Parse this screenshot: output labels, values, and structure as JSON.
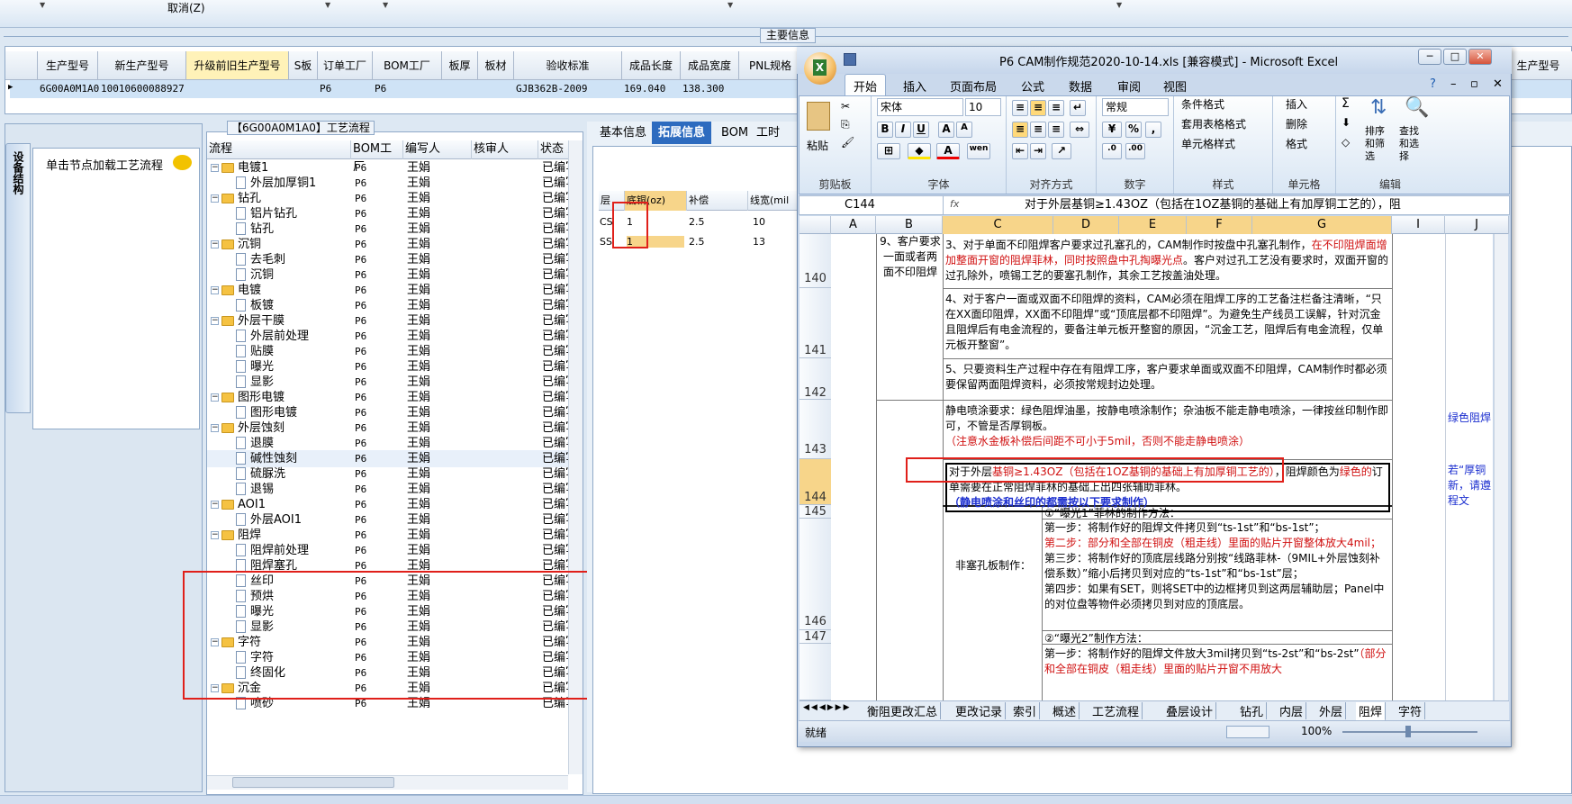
{
  "top": {
    "cancel_label": "取消(Z)"
  },
  "main_info": {
    "title": "主要信息",
    "headers": [
      "生产型号",
      "新生产型号",
      "升级前旧生产型号",
      "S板",
      "订单工厂",
      "BOM工厂",
      "板厚",
      "板材",
      "验收标准",
      "成品长度",
      "成品宽度",
      "PNL规格",
      "生产型号"
    ],
    "row": {
      "prod_no": "6G00A0M1A0",
      "new_prod_no": "10010600088927",
      "order_factory": "P6",
      "bom_factory": "P6",
      "standard": "GJB362B-2009",
      "length": "169.040",
      "width": "138.300"
    }
  },
  "left": {
    "vtab": "设备结构",
    "load_hint": "单击节点加载工艺流程"
  },
  "tree": {
    "title": "【6G00A0M1A0】工艺流程",
    "headers": [
      "流程",
      "BOM工厂",
      "编写人",
      "核审人",
      "状态"
    ],
    "rows": [
      {
        "name": "电镀1",
        "type": "group",
        "bom": "P6",
        "writer": "王娟",
        "status": "已编写"
      },
      {
        "name": "外层加厚铜1",
        "type": "item",
        "bom": "P6",
        "writer": "王娟",
        "status": "已编写"
      },
      {
        "name": "钻孔",
        "type": "group",
        "bom": "P6",
        "writer": "王娟",
        "status": "已编写"
      },
      {
        "name": "铝片钻孔",
        "type": "item",
        "bom": "P6",
        "writer": "王娟",
        "status": "已编写"
      },
      {
        "name": "钻孔",
        "type": "item",
        "bom": "P6",
        "writer": "王娟",
        "status": "已编写"
      },
      {
        "name": "沉铜",
        "type": "group",
        "bom": "P6",
        "writer": "王娟",
        "status": "已编写"
      },
      {
        "name": "去毛刺",
        "type": "item",
        "bom": "P6",
        "writer": "王娟",
        "status": "已编写"
      },
      {
        "name": "沉铜",
        "type": "item",
        "bom": "P6",
        "writer": "王娟",
        "status": "已编写"
      },
      {
        "name": "电镀",
        "type": "group",
        "bom": "P6",
        "writer": "王娟",
        "status": "已编写"
      },
      {
        "name": "板镀",
        "type": "item",
        "bom": "P6",
        "writer": "王娟",
        "status": "已编写"
      },
      {
        "name": "外层干膜",
        "type": "group",
        "bom": "P6",
        "writer": "王娟",
        "status": "已编写"
      },
      {
        "name": "外层前处理",
        "type": "item",
        "bom": "P6",
        "writer": "王娟",
        "status": "已编写"
      },
      {
        "name": "贴膜",
        "type": "item",
        "bom": "P6",
        "writer": "王娟",
        "status": "已编写"
      },
      {
        "name": "曝光",
        "type": "item",
        "bom": "P6",
        "writer": "王娟",
        "status": "已编写"
      },
      {
        "name": "显影",
        "type": "item",
        "bom": "P6",
        "writer": "王娟",
        "status": "已编写"
      },
      {
        "name": "图形电镀",
        "type": "group",
        "bom": "P6",
        "writer": "王娟",
        "status": "已编写"
      },
      {
        "name": "图形电镀",
        "type": "item",
        "bom": "P6",
        "writer": "王娟",
        "status": "已编写"
      },
      {
        "name": "外层蚀刻",
        "type": "group",
        "bom": "P6",
        "writer": "王娟",
        "status": "已编写"
      },
      {
        "name": "退膜",
        "type": "item",
        "bom": "P6",
        "writer": "王娟",
        "status": "已编写"
      },
      {
        "name": "碱性蚀刻",
        "type": "item",
        "bom": "P6",
        "writer": "王娟",
        "status": "已编写"
      },
      {
        "name": "硫脲洗",
        "type": "item",
        "bom": "P6",
        "writer": "王娟",
        "status": "已编写"
      },
      {
        "name": "退锡",
        "type": "item",
        "bom": "P6",
        "writer": "王娟",
        "status": "已编写"
      },
      {
        "name": "AOI1",
        "type": "group",
        "bom": "P6",
        "writer": "王娟",
        "status": "已编写"
      },
      {
        "name": "外层AOI1",
        "type": "item",
        "bom": "P6",
        "writer": "王娟",
        "status": "已编写"
      },
      {
        "name": "阻焊",
        "type": "group",
        "bom": "P6",
        "writer": "王娟",
        "status": "已编写"
      },
      {
        "name": "阻焊前处理",
        "type": "item",
        "bom": "P6",
        "writer": "王娟",
        "status": "已编写"
      },
      {
        "name": "阻焊塞孔",
        "type": "item",
        "bom": "P6",
        "writer": "王娟",
        "status": "已编写"
      },
      {
        "name": "丝印",
        "type": "item",
        "bom": "P6",
        "writer": "王娟",
        "status": "已编写"
      },
      {
        "name": "预烘",
        "type": "item",
        "bom": "P6",
        "writer": "王娟",
        "status": "已编写"
      },
      {
        "name": "曝光",
        "type": "item",
        "bom": "P6",
        "writer": "王娟",
        "status": "已编写"
      },
      {
        "name": "显影",
        "type": "item",
        "bom": "P6",
        "writer": "王娟",
        "status": "已编写"
      },
      {
        "name": "字符",
        "type": "group",
        "bom": "P6",
        "writer": "王娟",
        "status": "已编写"
      },
      {
        "name": "字符",
        "type": "item",
        "bom": "P6",
        "writer": "王娟",
        "status": "已编写"
      },
      {
        "name": "终固化",
        "type": "item",
        "bom": "P6",
        "writer": "王娟",
        "status": "已编写"
      },
      {
        "name": "沉金",
        "type": "group",
        "bom": "P6",
        "writer": "王娟",
        "status": "已编写"
      },
      {
        "name": "喷砂",
        "type": "item",
        "bom": "P6",
        "writer": "王娟",
        "status": "已编写"
      }
    ]
  },
  "right": {
    "tabs": [
      "基本信息",
      "拓展信息",
      "BOM",
      "工时"
    ],
    "active_tab": "拓展信息",
    "grid_headers": [
      "层",
      "底铜(oz)",
      "补偿",
      "线宽(mil"
    ],
    "grid_rows": [
      [
        "CS",
        "1",
        "2.5",
        "10"
      ],
      [
        "SS",
        "1",
        "2.5",
        "13"
      ]
    ]
  },
  "excel": {
    "title": "P6 CAM制作规范2020-10-14.xls [兼容模式] - Microsoft Excel",
    "ribbon_tabs": [
      "开始",
      "插入",
      "页面布局",
      "公式",
      "数据",
      "审阅",
      "视图"
    ],
    "font_name": "宋体",
    "font_size": "10",
    "number_format": "常规",
    "clipboard": {
      "paste": "粘贴",
      "label": "剪贴板"
    },
    "font_label": "字体",
    "align_label": "对齐方式",
    "number_label": "数字",
    "style_label": "样式",
    "cells_label": "单元格",
    "edit_label": "编辑",
    "style_btns": [
      "条件格式",
      "套用表格格式",
      "单元格样式"
    ],
    "cell_btns": [
      "插入",
      "删除",
      "格式"
    ],
    "edit_btns": [
      "排序和筛选",
      "查找和选择"
    ],
    "name_box": "C144",
    "formula": "对于外层基铜≥1.43OZ（包括在1OZ基铜的基础上有加厚铜工艺的），阻",
    "columns": [
      "A",
      "B",
      "C",
      "D",
      "E",
      "F",
      "G",
      "I",
      "J"
    ],
    "b_label": "9、客户要求一面或者两面不印阻焊",
    "r140": "3、对于单面不印阻焊客户要求过孔塞孔的，CAM制作时按盘中孔塞孔制作，",
    "r140_red": "在不印阻焊面增加整面开窗的阻焊菲林，同时按照盘中孔掏曝光点",
    "r140_tail": "。客户对过孔工艺没有要求时，双面开窗的过孔除外，喷锡工艺的要塞孔制作，其余工艺按盖油处理。",
    "r141": "4、对于客户一面或双面不印阻焊的资料，CAM必须在阻焊工序的工艺备注栏备注清晰，“只在XX面印阻焊，XX面不印阻焊”或“顶底层都不印阻焊”。为避免生产线员工误解，针对沉金且阻焊后有电金流程的，要备注单元板开整窗的原因，“沉金工艺，阻焊后有电金流程，仅单元板开整窗”。",
    "r142": "5、只要资料生产过程中存在有阻焊工序，客户要求单面或双面不印阻焊，CAM制作时都必须要保留两面阻焊资料，必须按常规封边处理。",
    "r143": "静电喷涂要求：绿色阻焊油墨，按静电喷涂制作；杂油板不能走静电喷涂，一律按丝印制作即可，不管是否厚铜板。",
    "r143_red": "（注意水金板补偿后间距不可小于5mil，否则不能走静电喷涂）",
    "r143_right": "绿色阻焊",
    "r144_a": "对于外层",
    "r144_red": "基铜≥1.43OZ（包括在1OZ基铜的基础上有加厚铜工艺的）",
    "r144_b": "，阻焊颜色为",
    "r144_c": "绿色的",
    "r144_d": "订单需要在正常阻焊菲林的基础上出四张辅助菲林。",
    "r144_blue": "（静电喷涂和丝印的都需按以下要求制作）",
    "r144_right": "若“厚铜新，请遵程文",
    "label_nonplug": "非塞孔板制作：",
    "r145": "①“曝光1”菲林的制作方法：",
    "r146_1": "第一步：将制作好的阻焊文件拷贝到“ts-1st”和“bs-1st”；",
    "r146_2": "第二步：部分和全部在铜皮（粗走线）里面的贴片开窗整体放大4mil；",
    "r146_3": "第三步：将制作好的顶底层线路分别按“线路菲林-（9MIL+外层蚀刻补偿系数）”缩小后拷贝到对应的“ts-1st”和“bs-1st”层；",
    "r146_4": "第四步：如果有SET，则将SET中的边框拷贝到这两层辅助层；Panel中的对位盘等物件必须拷贝到对应的顶底层。",
    "r147": "②“曝光2”制作方法：",
    "r148_1": "第一步：将制作好的阻焊文件放大3mil拷贝到“ts-2st”和“bs-2st”",
    "r148_red": "（部分和全部在铜皮（粗走线）里面的贴片开窗不用放大",
    "row_nums": [
      "140",
      "141",
      "142",
      "143",
      "144",
      "145",
      "146",
      "147"
    ],
    "sheet_tabs": [
      "衡阻更改汇总",
      "更改记录",
      "索引",
      "概述",
      "工艺流程",
      "叠层设计",
      "钻孔",
      "内层",
      "外层",
      "阻焊",
      "字符"
    ],
    "active_sheet": "阻焊",
    "status": "就绪",
    "zoom": "100%"
  }
}
